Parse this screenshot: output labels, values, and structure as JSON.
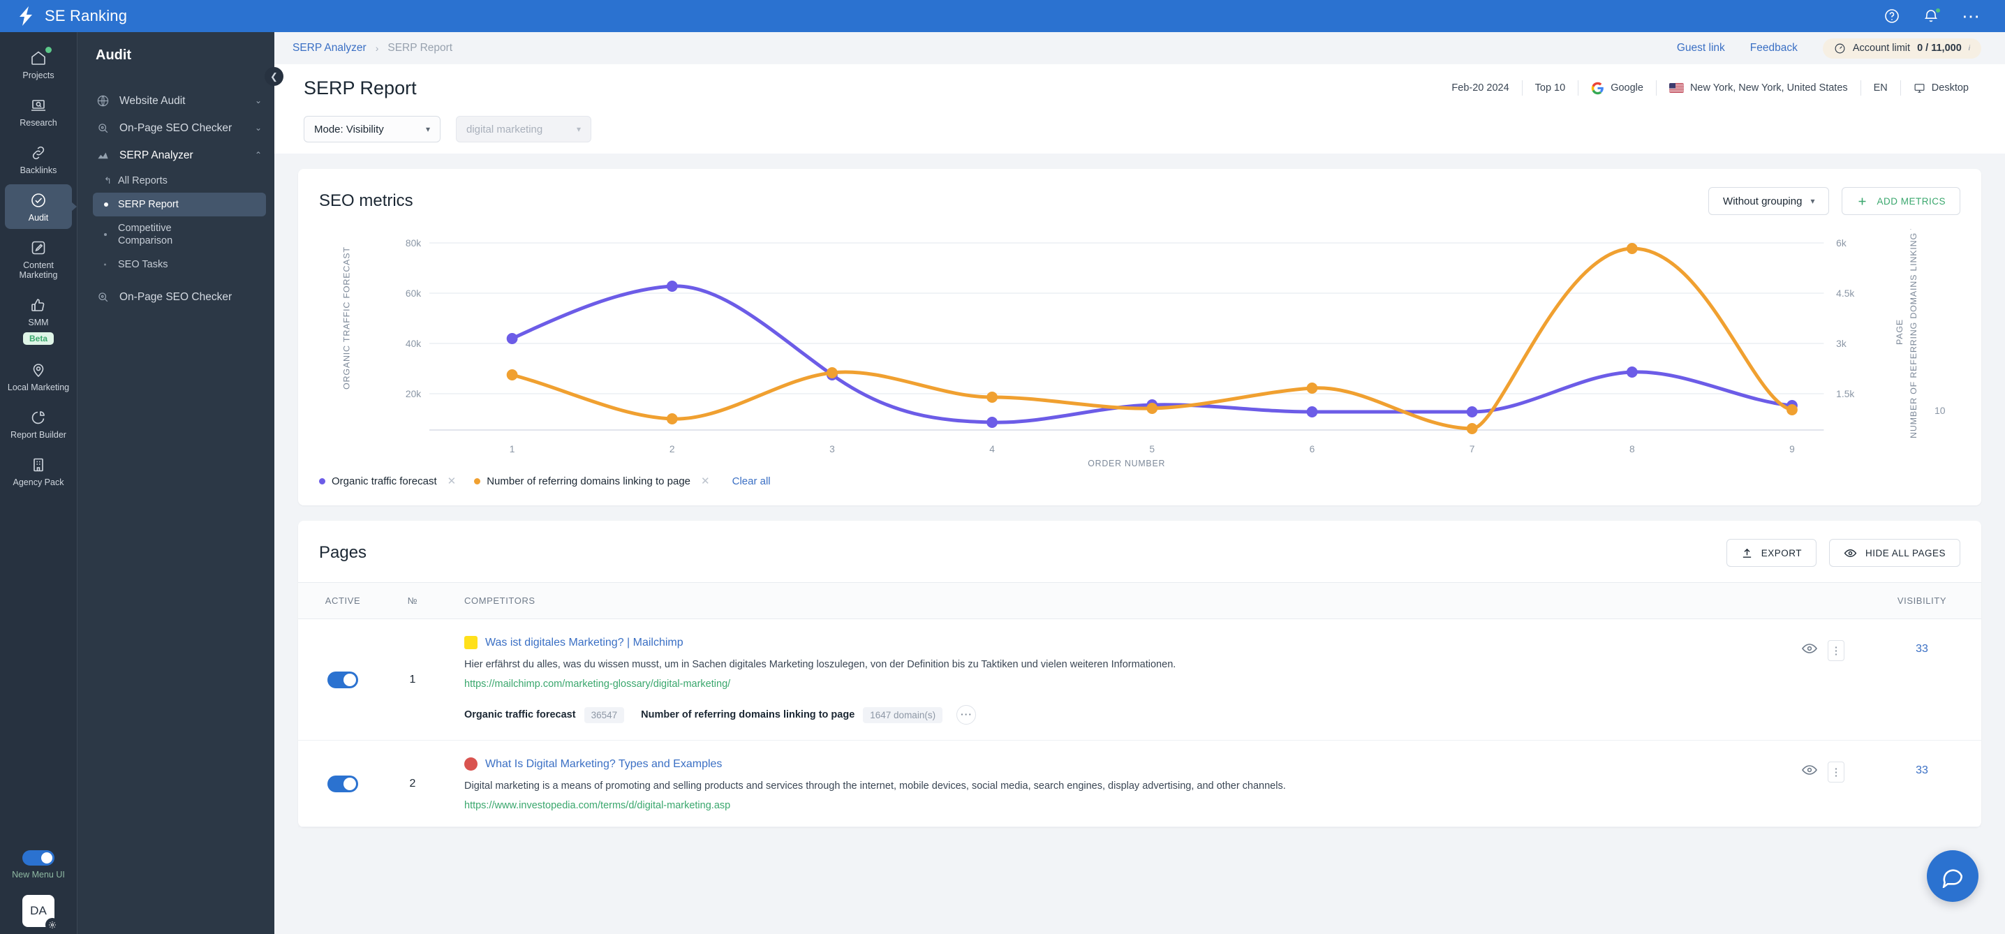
{
  "topbar": {
    "brand": "SE Ranking",
    "icons": [
      "help-icon",
      "notifications-icon",
      "more-icon"
    ]
  },
  "rail": {
    "items": [
      {
        "label": "Projects",
        "icon": "home-icon",
        "badge": null,
        "dot": true,
        "active": false
      },
      {
        "label": "Research",
        "icon": "laptop-search-icon",
        "badge": null,
        "dot": false,
        "active": false
      },
      {
        "label": "Backlinks",
        "icon": "link-icon",
        "badge": null,
        "dot": false,
        "active": false
      },
      {
        "label": "Audit",
        "icon": "check-circle-icon",
        "badge": null,
        "dot": false,
        "active": true
      },
      {
        "label": "Content Marketing",
        "icon": "edit-square-icon",
        "badge": null,
        "dot": false,
        "active": false
      },
      {
        "label": "SMM",
        "icon": "thumbs-up-icon",
        "badge": "Beta",
        "dot": false,
        "active": false
      },
      {
        "label": "Local Marketing",
        "icon": "pin-icon",
        "badge": null,
        "dot": false,
        "active": false
      },
      {
        "label": "Report Builder",
        "icon": "pie-chart-icon",
        "badge": null,
        "dot": false,
        "active": false
      },
      {
        "label": "Agency Pack",
        "icon": "building-icon",
        "badge": null,
        "dot": false,
        "active": false
      }
    ],
    "new_menu_label": "New Menu UI",
    "avatar_initials": "DA"
  },
  "navpanel": {
    "title": "Audit",
    "groups": [
      {
        "label": "Website Audit",
        "icon": "globe-icon",
        "chevron": "⌄",
        "expanded": false
      },
      {
        "label": "On-Page SEO Checker",
        "icon": "magnifier-icon",
        "chevron": "⌄",
        "expanded": false
      },
      {
        "label": "SERP Analyzer",
        "icon": "chart-area-icon",
        "chevron": "⌃",
        "expanded": true
      }
    ],
    "sub_items": [
      {
        "label": "All Reports",
        "mark": "arrow",
        "active": false
      },
      {
        "label": "SERP Report",
        "mark": "bullet",
        "active": true
      },
      {
        "label": "Competitive Comparison",
        "mark": "tiny",
        "active": false
      },
      {
        "label": "SEO Tasks",
        "mark": "tinier",
        "active": false
      }
    ],
    "footer_group": {
      "label": "On-Page SEO Checker",
      "icon": "magnifier-icon"
    }
  },
  "breadcrumb": {
    "parent": "SERP Analyzer",
    "separator": "›",
    "current": "SERP Report",
    "guest_link": "Guest link",
    "feedback": "Feedback",
    "account_limit_label": "Account limit",
    "account_limit_value": "0 / 11,000",
    "account_limit_sup": "i"
  },
  "header": {
    "title": "SERP Report",
    "meta": {
      "date": "Feb-20 2024",
      "top": "Top 10",
      "engine": "Google",
      "location": "New York, New York, United States",
      "language": "EN",
      "device": "Desktop"
    }
  },
  "filters": {
    "mode": "Mode: Visibility",
    "keyword": "digital marketing"
  },
  "seo_metrics": {
    "title": "SEO metrics",
    "grouping": "Without grouping",
    "add_metrics": "ADD METRICS",
    "legend": [
      {
        "label": "Organic traffic forecast",
        "color": "#6c5ce7"
      },
      {
        "label": "Number of referring domains linking to page",
        "color": "#f0a030"
      }
    ],
    "clear_all": "Clear all"
  },
  "chart_data": {
    "type": "line",
    "title": "SEO metrics",
    "xlabel": "ORDER NUMBER",
    "x": [
      1,
      2,
      3,
      4,
      5,
      6,
      7,
      8,
      9,
      10
    ],
    "xticks": [
      "1",
      "2",
      "3",
      "4",
      "5",
      "6",
      "7",
      "8",
      "9",
      "10"
    ],
    "grid": true,
    "legend_position": "bottom-left",
    "axes": [
      {
        "id": "left",
        "label": "ORGANIC TRAFFIC FORECAST",
        "ticks": [
          "20k",
          "40k",
          "60k",
          "80k"
        ],
        "tick_values": [
          20000,
          40000,
          60000,
          80000
        ],
        "ylim": [
          0,
          88000
        ]
      },
      {
        "id": "right",
        "label": "NUMBER OF REFERRING DOMAINS LINKING TO PAGE",
        "ticks": [
          "1.5k",
          "3k",
          "4.5k",
          "6k"
        ],
        "tick_values": [
          1500,
          3000,
          4500,
          6000
        ],
        "ylim": [
          0,
          6600
        ]
      }
    ],
    "series": [
      {
        "name": "Organic traffic forecast",
        "color": "#6c5ce7",
        "axis": "left",
        "values": [
          36547,
          65500,
          19500,
          3300,
          8100,
          4600,
          4600,
          19200,
          9300,
          null
        ]
      },
      {
        "name": "Number of referring domains linking to page",
        "color": "#f0a030",
        "axis": "right",
        "values": [
          1647,
          370,
          1760,
          990,
          680,
          1500,
          170,
          5800,
          530,
          null
        ]
      }
    ]
  },
  "pages": {
    "title": "Pages",
    "export_label": "EXPORT",
    "hide_all_label": "HIDE ALL PAGES",
    "columns": [
      "ACTIVE",
      "№",
      "COMPETITORS",
      "VISIBILITY"
    ],
    "rows": [
      {
        "active": true,
        "num": "1",
        "title": "Was ist digitales Marketing? | Mailchimp",
        "favicon_color": "#ffe01b",
        "description": "Hier erfährst du alles, was du wissen musst, um in Sachen digitales Marketing loszulegen, von der Definition bis zu Taktiken und vielen weiteren Informationen.",
        "url": "https://mailchimp.com/marketing-glossary/digital-marketing/",
        "metrics": [
          {
            "name": "Organic traffic forecast",
            "value": "36547"
          },
          {
            "name": "Number of referring domains linking to page",
            "value": "1647 domain(s)"
          }
        ],
        "visibility": "33"
      },
      {
        "active": true,
        "num": "2",
        "title": "What Is Digital Marketing? Types and Examples",
        "favicon_color": "#d9534f",
        "description": "Digital marketing is a means of promoting and selling products and services through the internet, mobile devices, social media, search engines, display advertising, and other channels.",
        "url": "https://www.investopedia.com/terms/d/digital-marketing.asp",
        "metrics": [],
        "visibility": "33"
      }
    ]
  },
  "colors": {
    "brand_blue": "#2b72d0",
    "accent_green": "#3aa76d",
    "series_purple": "#6c5ce7",
    "series_orange": "#f0a030",
    "link_blue": "#3a6fc4"
  }
}
